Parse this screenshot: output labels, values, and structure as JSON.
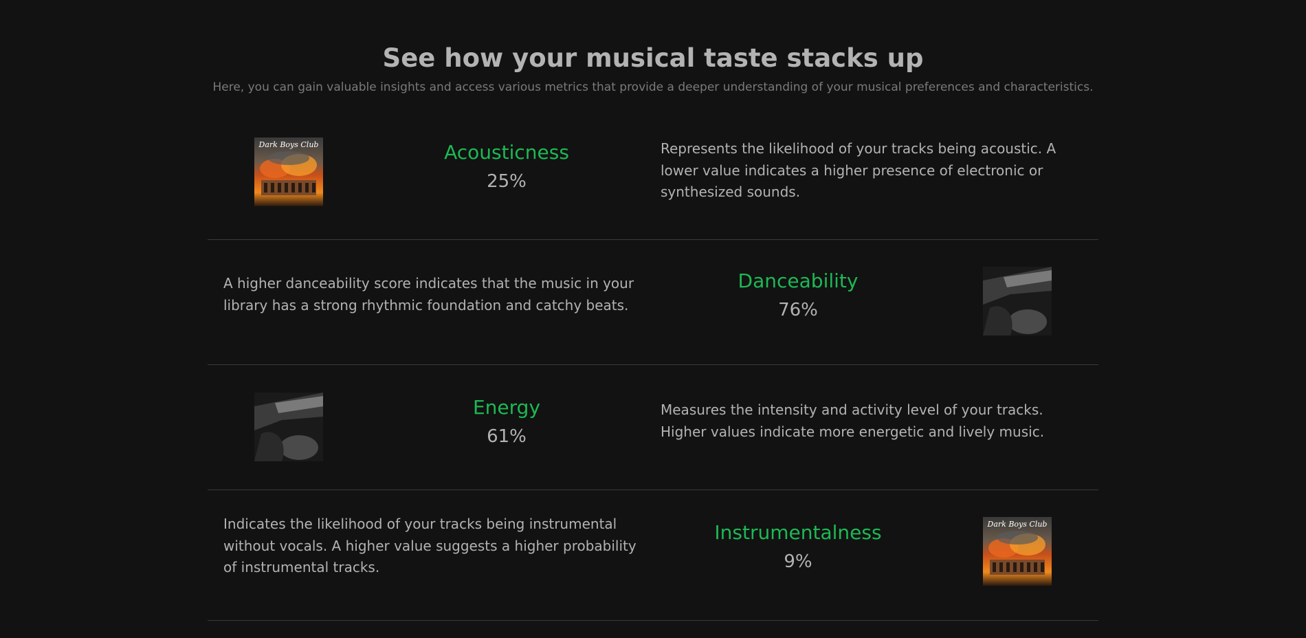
{
  "header": {
    "title": "See how your musical taste stacks up",
    "subtitle": "Here, you can gain valuable insights and access various metrics that provide a deeper understanding of your musical preferences and characteristics."
  },
  "colors": {
    "background": "#121212",
    "accent": "#1db954",
    "text": "#b3b3b3",
    "muted": "#7a7a7a",
    "divider": "#3a3a3a"
  },
  "metrics": [
    {
      "name": "Acousticness",
      "value": "25%",
      "description": "Represents the likelihood of your tracks being acoustic. A lower value indicates a higher presence of electronic or synthesized sounds.",
      "artwork": "fire-album-cover",
      "artwork_text": "Dark Boys Club"
    },
    {
      "name": "Danceability",
      "value": "76%",
      "description": "A higher danceability score indicates that the music in your library has a strong rhythmic foundation and catchy beats.",
      "artwork": "monochrome-album-cover"
    },
    {
      "name": "Energy",
      "value": "61%",
      "description": "Measures the intensity and activity level of your tracks. Higher values indicate more energetic and lively music.",
      "artwork": "monochrome-album-cover"
    },
    {
      "name": "Instrumentalness",
      "value": "9%",
      "description": "Indicates the likelihood of your tracks being instrumental without vocals. A higher value suggests a higher probability of instrumental tracks.",
      "artwork": "fire-album-cover",
      "artwork_text": "Dark Boys Club"
    }
  ]
}
